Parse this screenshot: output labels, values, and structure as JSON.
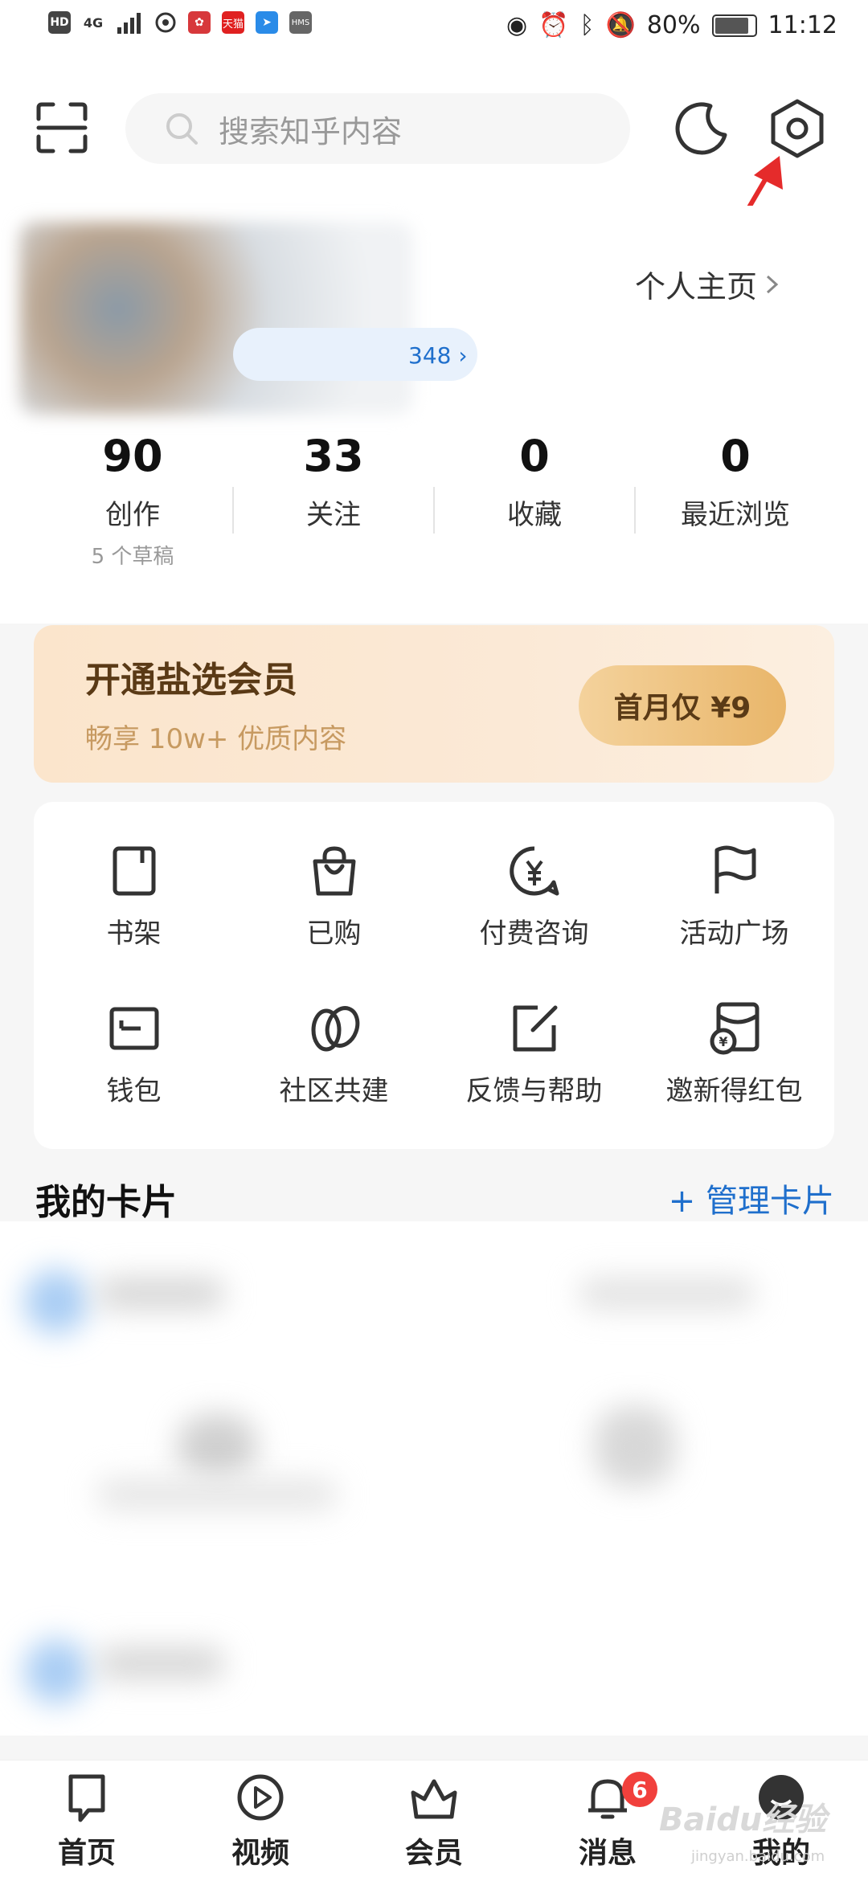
{
  "status_bar": {
    "left_icons": [
      "HD",
      "4G",
      "signal-icon",
      "netease-icon",
      "app-red-icon",
      "天猫",
      "paper-plane-icon",
      "HMS"
    ],
    "battery": "80%",
    "time": "11:12"
  },
  "header": {
    "search_placeholder": "搜索知乎内容"
  },
  "profile": {
    "id_suffix": "348 ›",
    "homepage_label": "个人主页",
    "stats": [
      {
        "num": "90",
        "label": "创作",
        "sub": "5 个草稿"
      },
      {
        "num": "33",
        "label": "关注"
      },
      {
        "num": "0",
        "label": "收藏"
      },
      {
        "num": "0",
        "label": "最近浏览"
      }
    ]
  },
  "vip": {
    "title": "开通盐选会员",
    "subtitle": "畅享 10w+ 优质内容",
    "button": "首月仅 ¥9"
  },
  "grid": [
    {
      "label": "书架",
      "icon": "bookshelf-icon"
    },
    {
      "label": "已购",
      "icon": "shopping-bag-icon"
    },
    {
      "label": "付费咨询",
      "icon": "paid-consult-icon"
    },
    {
      "label": "活动广场",
      "icon": "flag-icon"
    },
    {
      "label": "钱包",
      "icon": "wallet-icon"
    },
    {
      "label": "社区共建",
      "icon": "leaves-icon"
    },
    {
      "label": "反馈与帮助",
      "icon": "edit-icon"
    },
    {
      "label": "邀新得红包",
      "icon": "red-packet-icon"
    }
  ],
  "cards": {
    "title": "我的卡片",
    "manage": "+ 管理卡片"
  },
  "bottom_nav": [
    {
      "label": "首页",
      "icon": "home-icon"
    },
    {
      "label": "视频",
      "icon": "video-icon"
    },
    {
      "label": "会员",
      "icon": "crown-icon"
    },
    {
      "label": "消息",
      "icon": "bell-icon",
      "badge": "6"
    },
    {
      "label": "我的",
      "icon": "avatar-icon"
    }
  ],
  "watermark": {
    "text": "Baidu经验",
    "sub": "jingyan.baidu.com"
  }
}
